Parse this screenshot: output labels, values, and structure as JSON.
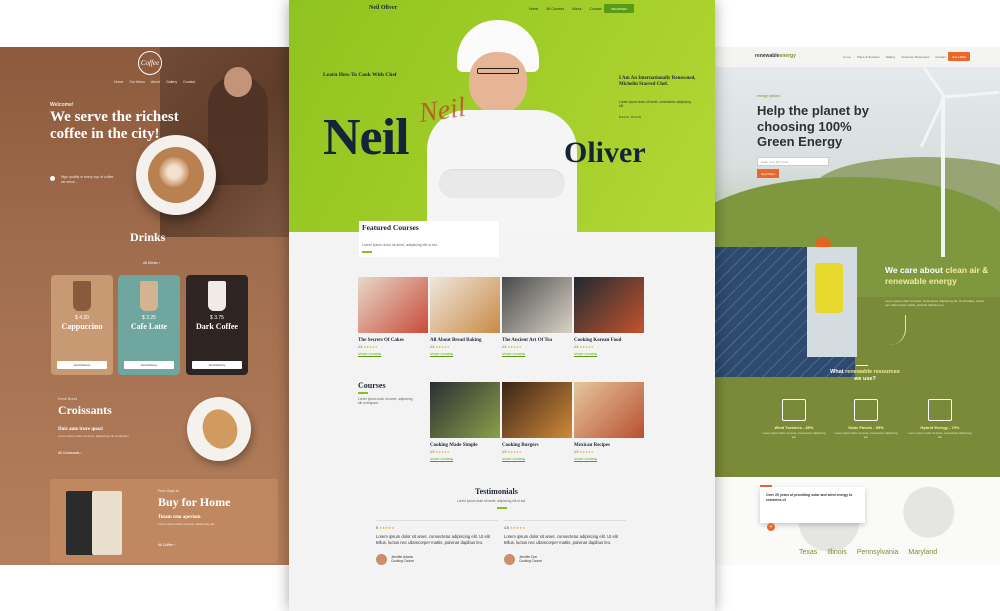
{
  "coffee": {
    "logo_text": "Coffee",
    "nav": [
      "Home",
      "Our Menu",
      "About",
      "Gallery",
      "Contact"
    ],
    "welcome": "Welcome!",
    "headline": "We serve the richest coffee in the city!",
    "bullet_text": "High quality in every cup of coffee we serve...",
    "drinks_title": "Drinks",
    "drinks_link": "All Drinks ›",
    "cards": [
      {
        "price": "$ 4.20",
        "name": "Cappuccino",
        "button": "Get Delivery",
        "bg": "#c89a74",
        "drink": "#8b5a3c"
      },
      {
        "price": "$ 3.25",
        "name": "Cafe Latte",
        "button": "Get Delivery",
        "bg": "#6fa7a0",
        "drink": "#d3b391"
      },
      {
        "price": "$ 3.75",
        "name": "Dark Coffee",
        "button": "Get Delivery",
        "bg": "#2e2522",
        "drink": "#f0ebe5"
      }
    ],
    "croissant_kicker": "Fresh Bread",
    "croissant_title": "Croissants",
    "croissant_sub": "Duis aute irure quasi",
    "croissant_text": "Lorem ipsum dolor sit amet, adipiscing elit ut aliquam.",
    "croissant_link": "All Croissants ›",
    "home_kicker": "From Bags to",
    "home_title": "Buy for Home",
    "home_sub": "Totam rem aperiam",
    "home_text": "Lorem ipsum dolor sit amet, adipiscing elit.",
    "home_link": "All Coffee ›"
  },
  "chef": {
    "site_name": "Neil Oliver",
    "nav": [
      "Home",
      "All Courses",
      "About",
      "Contact"
    ],
    "register": "REGISTER",
    "learn": "Learn How To Cook With Chef",
    "first_name": "Neil",
    "last_name": "Oliver",
    "signature": "Neil",
    "intl_title": "I Am An Internationally Renowned, Michelin Starred Chef.",
    "intl_text": "Lorem ipsum dolor sit amet, consectetur adipiscing elit.",
    "read_more": "READ MORE",
    "featured_title": "Featured Courses",
    "featured_text": "Lorem ipsum dolor sit amet, adipiscing elit ut est.",
    "featured_courses": [
      {
        "title": "The Secrets Of Cakes",
        "rating": "4.5",
        "stars": "★★★★★",
        "start": "START COURSE",
        "color1": "#e7d9c8",
        "color2": "#c94a3a"
      },
      {
        "title": "All About Bread Baking",
        "rating": "4.5",
        "stars": "★★★★★",
        "start": "START COURSE",
        "color1": "#efe7dc",
        "color2": "#c98a45"
      },
      {
        "title": "The Ancient Art Of Tea",
        "rating": "4.5",
        "stars": "★★★★★",
        "start": "START COURSE",
        "color1": "#4a4a4a",
        "color2": "#d9d2c6"
      },
      {
        "title": "Cooking Korean Food",
        "rating": "4.5",
        "stars": "★★★★★",
        "start": "START COURSE",
        "color1": "#1f2a30",
        "color2": "#c4532f"
      }
    ],
    "courses_title": "Courses",
    "courses_text": "Lorem ipsum dolor sit amet, adipiscing elit ut aliquam.",
    "courses": [
      {
        "title": "Cooking Made Simple",
        "rating": "4.5",
        "stars": "★★★★★",
        "start": "START COURSE",
        "color1": "#2a2f33",
        "color2": "#8aa04a"
      },
      {
        "title": "Cooking Burgers",
        "rating": "4.5",
        "stars": "★★★★★",
        "start": "START COURSE",
        "color1": "#3a2418",
        "color2": "#d08a38"
      },
      {
        "title": "Mexican Recipes",
        "rating": "4.5",
        "stars": "★★★★★",
        "start": "START COURSE",
        "color1": "#e6c7a0",
        "color2": "#b8502e"
      }
    ],
    "testimonials_title": "Testimonials",
    "testimonials_text": "Lorem ipsum dolor sit amet, adipiscing elit ut est.",
    "testimonials": [
      {
        "rating": "5",
        "stars": "★★★★★",
        "quote": "Lorem ipsum dolor sit amet, consectetur adipiscing elit. Ut elit tellus, luctus nec ullamcorper mattis, pulvinar dapibus leo.",
        "name": "Jennifer Adams",
        "role": "Cooking Course"
      },
      {
        "rating": "4.5",
        "stars": "★★★★★",
        "quote": "Lorem ipsum dolor sit amet, consectetur adipiscing elit. Ut elit tellus, luctus nec ullamcorper mattis, pulvinar dapibus leo.",
        "name": "Jennifer Doe",
        "role": "Cooking Course"
      }
    ]
  },
  "energy": {
    "logo": "renewable",
    "logo_accent": "energy",
    "nav": [
      "Home",
      "Plans & Services",
      "Gallery",
      "Customer Resources",
      "Contact"
    ],
    "cta": "Get a Plan",
    "kicker": "energy options",
    "headline_pre": "Help the planet by choosing",
    "headline_bold": "100% Green Energy",
    "email_placeholder": "Enter your ZIP Code",
    "subscribe": "See Plans",
    "care_pre": "We care about",
    "care_bold": "clean air & renewable energy",
    "care_text": "Lorem ipsum dolor sit amet, consectetur adipiscing elit. Ut elit tellus, luctus nec ullamcorper mattis, pulvinar dapibus leo.",
    "what_pre": "What",
    "what_bold": "renewable resources",
    "what_post": "we use?",
    "resources": [
      {
        "label": "Wind Turbines - 85%",
        "text": "Lorem ipsum dolor sit amet, consectetur adipiscing elit."
      },
      {
        "label": "Solar Panels - 95%",
        "text": "Lorem ipsum dolor sit amet, consectetur adipiscing elit."
      },
      {
        "label": "Hybrid Energy - 70%",
        "text": "Lorem ipsum dolor sit amet, consectetur adipiscing elit."
      }
    ],
    "years_text": "Over 20 years of providing solar and wind energy to residents of",
    "states": [
      "Texas",
      "Illinois",
      "Pennsylvania",
      "Maryland"
    ]
  }
}
